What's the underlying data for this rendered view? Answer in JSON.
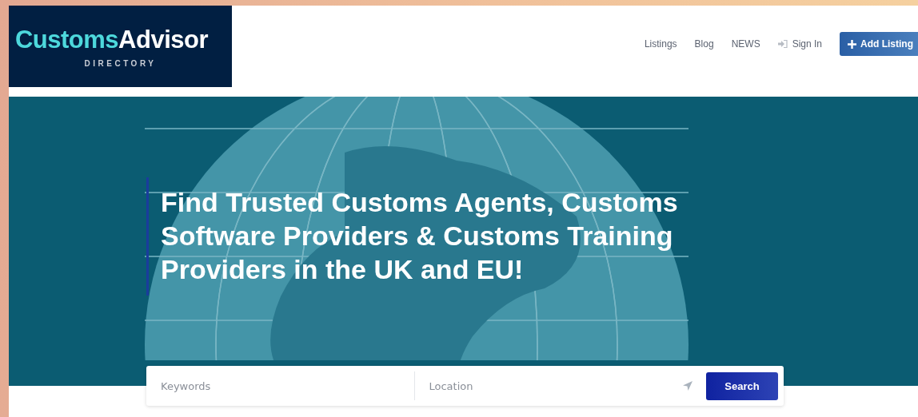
{
  "logo": {
    "brand_first": "Customs",
    "brand_second": "Advisor",
    "tagline": "DIRECTORY"
  },
  "nav": [
    {
      "label": "Listings",
      "kind": "link"
    },
    {
      "label": "Blog",
      "kind": "link"
    },
    {
      "label": "NEWS",
      "kind": "link"
    },
    {
      "label": "Sign In",
      "kind": "signin"
    },
    {
      "label": "Add Listing",
      "kind": "button"
    }
  ],
  "hero": {
    "heading": "Find Trusted Customs Agents, Customs Software Providers & Customs Training Providers in the UK and EU!"
  },
  "search": {
    "keywords_placeholder": "Keywords",
    "location_placeholder": "Location",
    "button": "Search"
  }
}
